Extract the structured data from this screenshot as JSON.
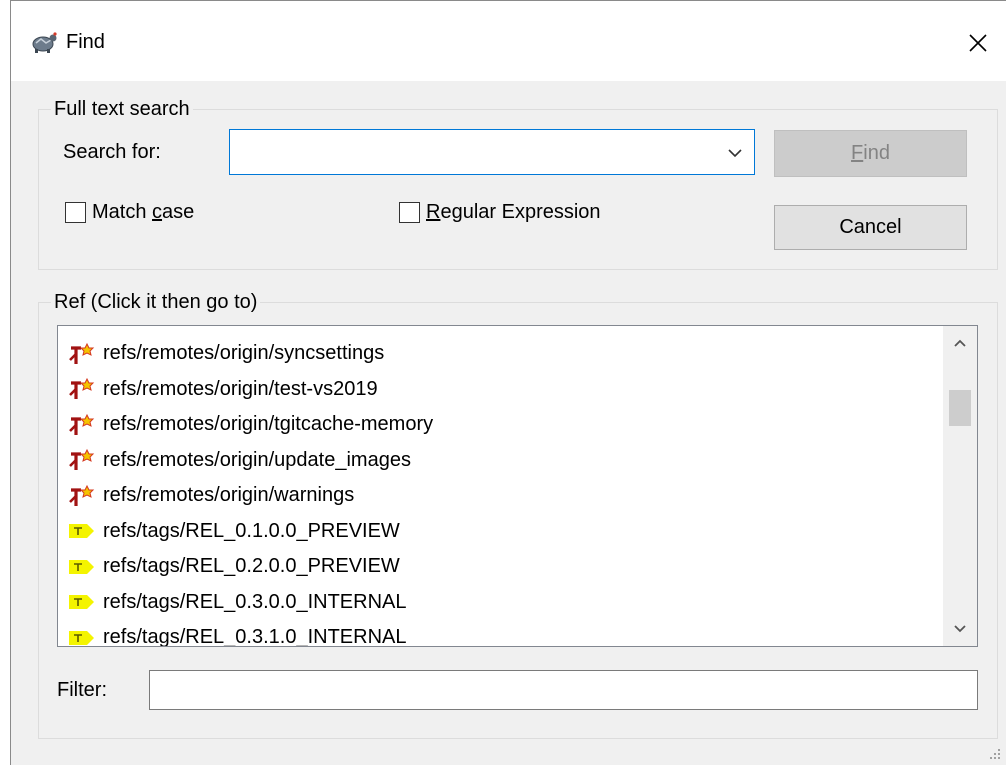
{
  "window": {
    "title": "Find",
    "icon": "tortoise-icon",
    "close_glyph": "✕"
  },
  "search_group": {
    "legend": "Full text search",
    "search_label": "Search for:",
    "search_value": "",
    "find_button": {
      "before": "",
      "accel": "F",
      "after": "ind",
      "enabled": false
    },
    "cancel_button": "Cancel",
    "match_case": {
      "before": "Match ",
      "accel": "c",
      "after": "ase",
      "checked": false
    },
    "regex": {
      "before": "",
      "accel": "R",
      "after": "egular Expression",
      "checked": false
    }
  },
  "ref_group": {
    "legend": "Ref (Click it then go to)",
    "items": [
      {
        "icon": "remote-branch-icon",
        "label": "refs/remotes/origin/syncsettings"
      },
      {
        "icon": "remote-branch-icon",
        "label": "refs/remotes/origin/test-vs2019"
      },
      {
        "icon": "remote-branch-icon",
        "label": "refs/remotes/origin/tgitcache-memory"
      },
      {
        "icon": "remote-branch-icon",
        "label": "refs/remotes/origin/update_images"
      },
      {
        "icon": "remote-branch-icon",
        "label": "refs/remotes/origin/warnings"
      },
      {
        "icon": "tag-icon",
        "label": "refs/tags/REL_0.1.0.0_PREVIEW"
      },
      {
        "icon": "tag-icon",
        "label": "refs/tags/REL_0.2.0.0_PREVIEW"
      },
      {
        "icon": "tag-icon",
        "label": "refs/tags/REL_0.3.0.0_INTERNAL"
      },
      {
        "icon": "tag-icon",
        "label": "refs/tags/REL_0.3.1.0_INTERNAL"
      }
    ],
    "filter_label": "Filter:",
    "filter_value": ""
  },
  "colors": {
    "dialog_bg": "#f0f0f0",
    "focus_border": "#0078d7",
    "remote_icon": "#a11212",
    "tag_icon": "#f4f400"
  }
}
